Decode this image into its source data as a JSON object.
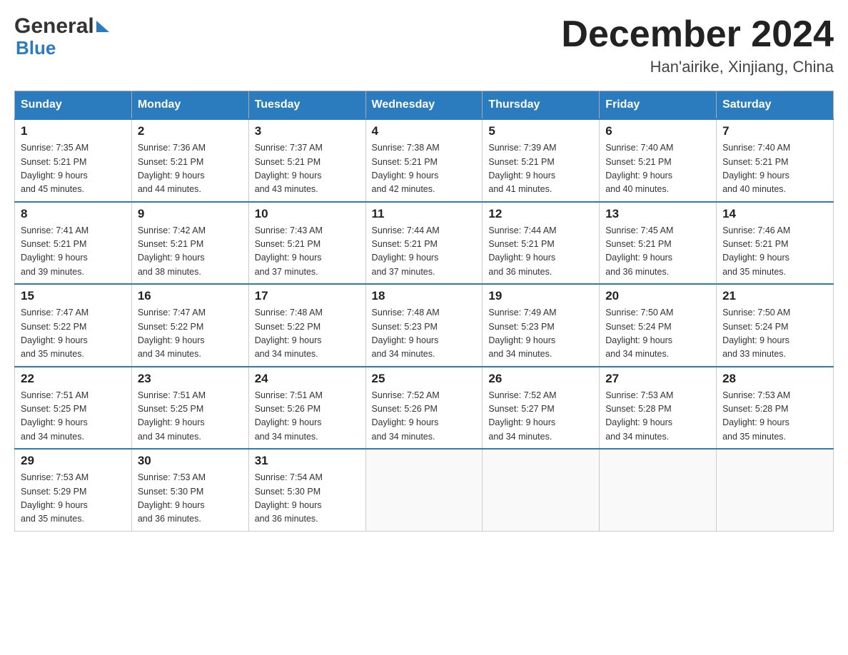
{
  "header": {
    "logo_general": "General",
    "logo_blue": "Blue",
    "title": "December 2024",
    "subtitle": "Han'airike, Xinjiang, China"
  },
  "days_of_week": [
    "Sunday",
    "Monday",
    "Tuesday",
    "Wednesday",
    "Thursday",
    "Friday",
    "Saturday"
  ],
  "weeks": [
    [
      {
        "day": "1",
        "sunrise": "7:35 AM",
        "sunset": "5:21 PM",
        "daylight": "9 hours and 45 minutes."
      },
      {
        "day": "2",
        "sunrise": "7:36 AM",
        "sunset": "5:21 PM",
        "daylight": "9 hours and 44 minutes."
      },
      {
        "day": "3",
        "sunrise": "7:37 AM",
        "sunset": "5:21 PM",
        "daylight": "9 hours and 43 minutes."
      },
      {
        "day": "4",
        "sunrise": "7:38 AM",
        "sunset": "5:21 PM",
        "daylight": "9 hours and 42 minutes."
      },
      {
        "day": "5",
        "sunrise": "7:39 AM",
        "sunset": "5:21 PM",
        "daylight": "9 hours and 41 minutes."
      },
      {
        "day": "6",
        "sunrise": "7:40 AM",
        "sunset": "5:21 PM",
        "daylight": "9 hours and 40 minutes."
      },
      {
        "day": "7",
        "sunrise": "7:40 AM",
        "sunset": "5:21 PM",
        "daylight": "9 hours and 40 minutes."
      }
    ],
    [
      {
        "day": "8",
        "sunrise": "7:41 AM",
        "sunset": "5:21 PM",
        "daylight": "9 hours and 39 minutes."
      },
      {
        "day": "9",
        "sunrise": "7:42 AM",
        "sunset": "5:21 PM",
        "daylight": "9 hours and 38 minutes."
      },
      {
        "day": "10",
        "sunrise": "7:43 AM",
        "sunset": "5:21 PM",
        "daylight": "9 hours and 37 minutes."
      },
      {
        "day": "11",
        "sunrise": "7:44 AM",
        "sunset": "5:21 PM",
        "daylight": "9 hours and 37 minutes."
      },
      {
        "day": "12",
        "sunrise": "7:44 AM",
        "sunset": "5:21 PM",
        "daylight": "9 hours and 36 minutes."
      },
      {
        "day": "13",
        "sunrise": "7:45 AM",
        "sunset": "5:21 PM",
        "daylight": "9 hours and 36 minutes."
      },
      {
        "day": "14",
        "sunrise": "7:46 AM",
        "sunset": "5:21 PM",
        "daylight": "9 hours and 35 minutes."
      }
    ],
    [
      {
        "day": "15",
        "sunrise": "7:47 AM",
        "sunset": "5:22 PM",
        "daylight": "9 hours and 35 minutes."
      },
      {
        "day": "16",
        "sunrise": "7:47 AM",
        "sunset": "5:22 PM",
        "daylight": "9 hours and 34 minutes."
      },
      {
        "day": "17",
        "sunrise": "7:48 AM",
        "sunset": "5:22 PM",
        "daylight": "9 hours and 34 minutes."
      },
      {
        "day": "18",
        "sunrise": "7:48 AM",
        "sunset": "5:23 PM",
        "daylight": "9 hours and 34 minutes."
      },
      {
        "day": "19",
        "sunrise": "7:49 AM",
        "sunset": "5:23 PM",
        "daylight": "9 hours and 34 minutes."
      },
      {
        "day": "20",
        "sunrise": "7:50 AM",
        "sunset": "5:24 PM",
        "daylight": "9 hours and 34 minutes."
      },
      {
        "day": "21",
        "sunrise": "7:50 AM",
        "sunset": "5:24 PM",
        "daylight": "9 hours and 33 minutes."
      }
    ],
    [
      {
        "day": "22",
        "sunrise": "7:51 AM",
        "sunset": "5:25 PM",
        "daylight": "9 hours and 34 minutes."
      },
      {
        "day": "23",
        "sunrise": "7:51 AM",
        "sunset": "5:25 PM",
        "daylight": "9 hours and 34 minutes."
      },
      {
        "day": "24",
        "sunrise": "7:51 AM",
        "sunset": "5:26 PM",
        "daylight": "9 hours and 34 minutes."
      },
      {
        "day": "25",
        "sunrise": "7:52 AM",
        "sunset": "5:26 PM",
        "daylight": "9 hours and 34 minutes."
      },
      {
        "day": "26",
        "sunrise": "7:52 AM",
        "sunset": "5:27 PM",
        "daylight": "9 hours and 34 minutes."
      },
      {
        "day": "27",
        "sunrise": "7:53 AM",
        "sunset": "5:28 PM",
        "daylight": "9 hours and 34 minutes."
      },
      {
        "day": "28",
        "sunrise": "7:53 AM",
        "sunset": "5:28 PM",
        "daylight": "9 hours and 35 minutes."
      }
    ],
    [
      {
        "day": "29",
        "sunrise": "7:53 AM",
        "sunset": "5:29 PM",
        "daylight": "9 hours and 35 minutes."
      },
      {
        "day": "30",
        "sunrise": "7:53 AM",
        "sunset": "5:30 PM",
        "daylight": "9 hours and 36 minutes."
      },
      {
        "day": "31",
        "sunrise": "7:54 AM",
        "sunset": "5:30 PM",
        "daylight": "9 hours and 36 minutes."
      },
      null,
      null,
      null,
      null
    ]
  ],
  "labels": {
    "sunrise": "Sunrise:",
    "sunset": "Sunset:",
    "daylight": "Daylight:"
  }
}
